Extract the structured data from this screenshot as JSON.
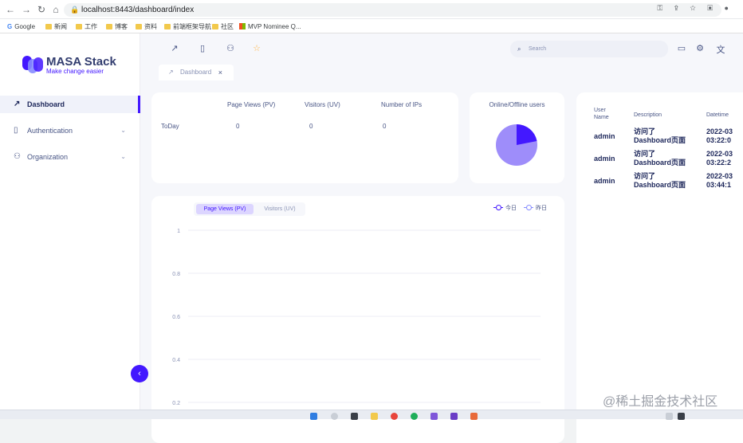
{
  "browser": {
    "url": "localhost:8443/dashboard/index",
    "bookmarks": [
      "Google",
      "新闻",
      "工作",
      "博客",
      "资料",
      "前端框架导航",
      "社区",
      "MVP Nominee Q..."
    ]
  },
  "app": {
    "logo_title": "MASA Stack",
    "logo_subtitle": "Make change easier",
    "brand_color": "#4318ff",
    "menu": [
      {
        "label": "Dashboard",
        "icon": "trend-icon",
        "active": true
      },
      {
        "label": "Authentication",
        "icon": "file-icon",
        "active": false
      },
      {
        "label": "Organization",
        "icon": "user-icon",
        "active": false
      }
    ],
    "search_placeholder": "Search",
    "tab_label": "Dashboard"
  },
  "stats": {
    "headers": [
      "Page Views (PV)",
      "Visitors (UV)",
      "Number of IPs"
    ],
    "row_label": "ToDay",
    "values": [
      "0",
      "0",
      "0"
    ]
  },
  "online": {
    "title": "Online/Offline users"
  },
  "log": {
    "headers": [
      "User Name",
      "Description",
      "Datetime"
    ],
    "rows": [
      {
        "user": "admin",
        "desc1": "访问了",
        "desc2": "Dashboard页面",
        "dt1": "2022-03",
        "dt2": "03:22:0"
      },
      {
        "user": "admin",
        "desc1": "访问了",
        "desc2": "Dashboard页面",
        "dt1": "2022-03",
        "dt2": "03:22:2"
      },
      {
        "user": "admin",
        "desc1": "访问了",
        "desc2": "Dashboard页面",
        "dt1": "2022-03",
        "dt2": "03:44:1"
      }
    ]
  },
  "chart_controls": {
    "seg_pv": "Page Views (PV)",
    "seg_uv": "Visitors (UV)",
    "legend_today": "今日",
    "legend_yesterday": "昨日"
  },
  "chart_data": {
    "type": "line",
    "ylim": [
      0,
      1
    ],
    "y_ticks": [
      "1",
      "0.8",
      "0.6",
      "0.4",
      "0.2"
    ],
    "series": [
      {
        "name": "今日",
        "values": []
      },
      {
        "name": "昨日",
        "values": []
      }
    ],
    "colors": {
      "today": "#4318ff",
      "yesterday": "#868cff"
    }
  },
  "watermark": "@稀土掘金技术社区"
}
